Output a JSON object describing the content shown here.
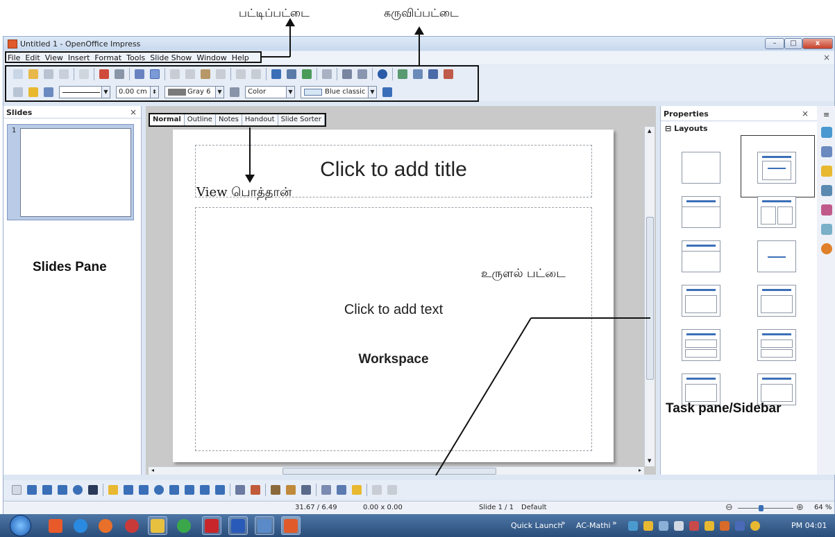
{
  "annotations": {
    "menubar_label": "பட்டிப்பட்டை",
    "toolbar_label": "கருவிப்பட்டை",
    "view_buttons_label": "View பொத்தான்",
    "scrollbar_label": "உருளல் பட்டை",
    "slides_pane_label": "Slides Pane",
    "workspace_label": "Workspace",
    "sidebar_label": "Task pane/Sidebar"
  },
  "window": {
    "title": "Untitled 1 - OpenOffice Impress",
    "minimize": "–",
    "maximize": "□",
    "close": "x",
    "doc_close": "×"
  },
  "menu": [
    "File",
    "Edit",
    "View",
    "Insert",
    "Format",
    "Tools",
    "Slide Show",
    "Window",
    "Help"
  ],
  "toolbar2": {
    "line_width": "0.00 cm",
    "line_color": "Gray 6",
    "fill_type": "Color",
    "fill_value": "Blue classic"
  },
  "slides_pane": {
    "title": "Slides",
    "close": "×",
    "slide_number": "1"
  },
  "view_tabs": [
    "Normal",
    "Outline",
    "Notes",
    "Handout",
    "Slide Sorter"
  ],
  "active_view_tab": "Normal",
  "slide": {
    "title_placeholder": "Click to add title",
    "body_placeholder": "Click to add text"
  },
  "sidebar": {
    "title": "Properties",
    "close": "×",
    "menu": "≡",
    "section": "Layouts",
    "section_toggle": "⊟"
  },
  "status": {
    "position": "31.67 / 6.49",
    "size": "0.00 x 0.00",
    "slide": "Slide 1 / 1",
    "master": "Default",
    "zoom": "64 %"
  },
  "taskbar": {
    "quick_launch": "Quick Launch",
    "user": "AC-Mathi",
    "more": "»",
    "time": "PM 04:01"
  },
  "colors": {
    "accent": "#3a6fb8",
    "workspace_bg": "#c9c9c9",
    "taskbar": "#2a4d7a"
  }
}
